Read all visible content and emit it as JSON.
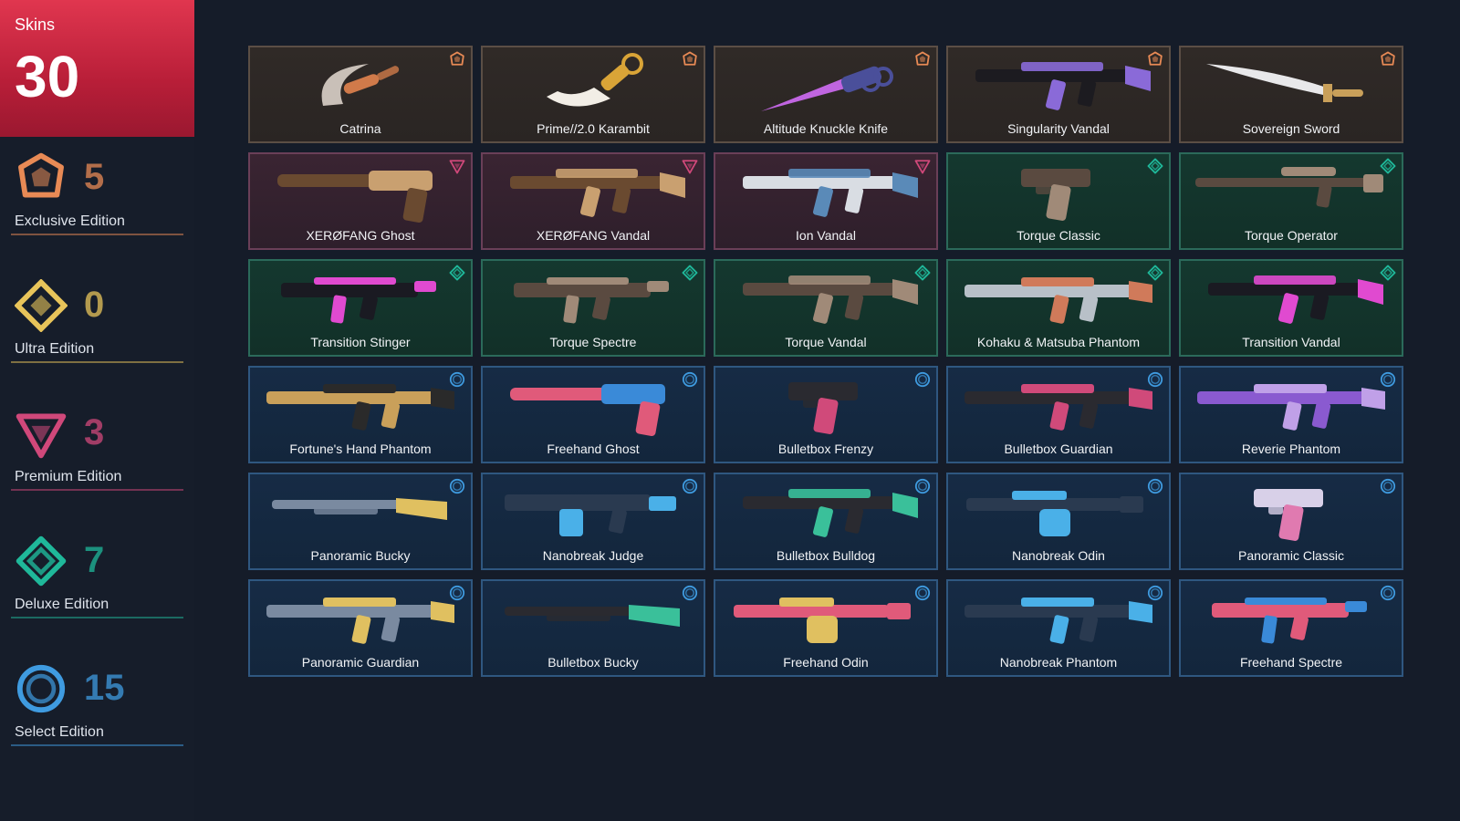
{
  "header": {
    "label": "Skins",
    "total": "30"
  },
  "tiers": [
    {
      "key": "exclusive",
      "label": "Exclusive Edition",
      "count": "5",
      "color": "#e88a55",
      "icon": "exclusive-edition-icon"
    },
    {
      "key": "ultra",
      "label": "Ultra Edition",
      "count": "0",
      "color": "#e8c45a",
      "icon": "ultra-edition-icon"
    },
    {
      "key": "premium",
      "label": "Premium Edition",
      "count": "3",
      "color": "#d0487a",
      "icon": "premium-edition-icon"
    },
    {
      "key": "deluxe",
      "label": "Deluxe Edition",
      "count": "7",
      "color": "#1fb89a",
      "icon": "deluxe-edition-icon"
    },
    {
      "key": "select",
      "label": "Select Edition",
      "count": "15",
      "color": "#3f9be0",
      "icon": "select-edition-icon"
    }
  ],
  "skins": [
    {
      "name": "Catrina",
      "tier": "exclusive",
      "kind": "knife-curved",
      "colors": [
        "#c9c0b8",
        "#d07a4a"
      ]
    },
    {
      "name": "Prime//2.0 Karambit",
      "tier": "exclusive",
      "kind": "karambit",
      "colors": [
        "#f2eee6",
        "#d9a437"
      ]
    },
    {
      "name": "Altitude Knuckle Knife",
      "tier": "exclusive",
      "kind": "knife-straight",
      "colors": [
        "#c065e0",
        "#4a4f9a"
      ]
    },
    {
      "name": "Singularity Vandal",
      "tier": "exclusive",
      "kind": "rifle",
      "colors": [
        "#1c1b20",
        "#8a6ad8"
      ]
    },
    {
      "name": "Sovereign Sword",
      "tier": "exclusive",
      "kind": "sword",
      "colors": [
        "#e8e8ea",
        "#c9a05a"
      ]
    },
    {
      "name": "XERØFANG Ghost",
      "tier": "premium",
      "kind": "pistol-long",
      "colors": [
        "#6a4a30",
        "#c9a070"
      ]
    },
    {
      "name": "XERØFANG Vandal",
      "tier": "premium",
      "kind": "rifle",
      "colors": [
        "#6a4a30",
        "#c9a070"
      ]
    },
    {
      "name": "Ion Vandal",
      "tier": "premium",
      "kind": "rifle",
      "colors": [
        "#d9dde3",
        "#5a8ab8"
      ]
    },
    {
      "name": "Torque Classic",
      "tier": "deluxe",
      "kind": "pistol",
      "colors": [
        "#5a4a40",
        "#a08a78"
      ]
    },
    {
      "name": "Torque Operator",
      "tier": "deluxe",
      "kind": "sniper",
      "colors": [
        "#5a4a40",
        "#a08a78"
      ]
    },
    {
      "name": "Transition Stinger",
      "tier": "deluxe",
      "kind": "smg",
      "colors": [
        "#1a1a22",
        "#e04ad0"
      ]
    },
    {
      "name": "Torque Spectre",
      "tier": "deluxe",
      "kind": "smg",
      "colors": [
        "#5a4a40",
        "#a08a78"
      ]
    },
    {
      "name": "Torque Vandal",
      "tier": "deluxe",
      "kind": "rifle",
      "colors": [
        "#5a4a40",
        "#a08a78"
      ]
    },
    {
      "name": "Kohaku & Matsuba Phantom",
      "tier": "deluxe",
      "kind": "rifle-long",
      "colors": [
        "#b8c0c8",
        "#d07a5a"
      ]
    },
    {
      "name": "Transition Vandal",
      "tier": "deluxe",
      "kind": "rifle",
      "colors": [
        "#1a1a22",
        "#e04ad0"
      ]
    },
    {
      "name": "Fortune's Hand Phantom",
      "tier": "select",
      "kind": "rifle-long",
      "colors": [
        "#c9a05a",
        "#2a2a2a"
      ]
    },
    {
      "name": "Freehand Ghost",
      "tier": "select",
      "kind": "pistol-long",
      "colors": [
        "#e05a7a",
        "#3a8ad8"
      ]
    },
    {
      "name": "Bulletbox Frenzy",
      "tier": "select",
      "kind": "pistol",
      "colors": [
        "#2a2a30",
        "#d04a7a"
      ]
    },
    {
      "name": "Bulletbox Guardian",
      "tier": "select",
      "kind": "rifle-long",
      "colors": [
        "#2a2a30",
        "#d04a7a"
      ]
    },
    {
      "name": "Reverie Phantom",
      "tier": "select",
      "kind": "rifle-long",
      "colors": [
        "#8a5ad0",
        "#c0a0e8"
      ]
    },
    {
      "name": "Panoramic Bucky",
      "tier": "select",
      "kind": "shotgun",
      "colors": [
        "#7a8aa0",
        "#e0c060"
      ]
    },
    {
      "name": "Nanobreak Judge",
      "tier": "select",
      "kind": "shotgun-heavy",
      "colors": [
        "#2a3a50",
        "#4ab0e8"
      ]
    },
    {
      "name": "Bulletbox Bulldog",
      "tier": "select",
      "kind": "rifle",
      "colors": [
        "#2a2a30",
        "#3ac09a"
      ]
    },
    {
      "name": "Nanobreak Odin",
      "tier": "select",
      "kind": "lmg",
      "colors": [
        "#2a3a50",
        "#4ab0e8"
      ]
    },
    {
      "name": "Panoramic Classic",
      "tier": "select",
      "kind": "pistol",
      "colors": [
        "#d8d0e8",
        "#e07ab0"
      ]
    },
    {
      "name": "Panoramic Guardian",
      "tier": "select",
      "kind": "rifle-long",
      "colors": [
        "#7a8aa0",
        "#e0c060"
      ]
    },
    {
      "name": "Bulletbox Bucky",
      "tier": "select",
      "kind": "shotgun",
      "colors": [
        "#2a2a30",
        "#3ac09a"
      ]
    },
    {
      "name": "Freehand Odin",
      "tier": "select",
      "kind": "lmg",
      "colors": [
        "#e05a7a",
        "#e0c060"
      ]
    },
    {
      "name": "Nanobreak Phantom",
      "tier": "select",
      "kind": "rifle-long",
      "colors": [
        "#2a3a50",
        "#4ab0e8"
      ]
    },
    {
      "name": "Freehand Spectre",
      "tier": "select",
      "kind": "smg",
      "colors": [
        "#e05a7a",
        "#3a8ad8"
      ]
    }
  ]
}
